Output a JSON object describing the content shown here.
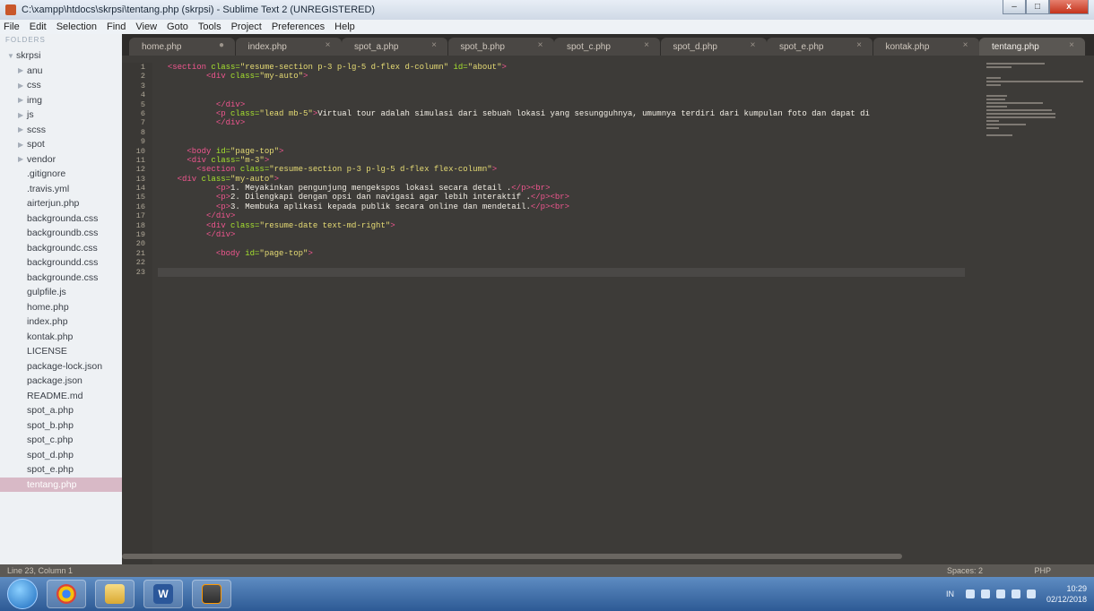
{
  "window": {
    "title": "C:\\xampp\\htdocs\\skrpsi\\tentang.php (skrpsi) - Sublime Text 2 (UNREGISTERED)",
    "controls": [
      "–",
      "□",
      "x"
    ]
  },
  "menu": [
    "File",
    "Edit",
    "Selection",
    "Find",
    "View",
    "Goto",
    "Tools",
    "Project",
    "Preferences",
    "Help"
  ],
  "sidebar": {
    "header": "FOLDERS",
    "items": [
      {
        "label": "skrpsi",
        "kind": "folder-open",
        "depth": 0
      },
      {
        "label": "anu",
        "kind": "folder",
        "depth": 1
      },
      {
        "label": "css",
        "kind": "folder",
        "depth": 1
      },
      {
        "label": "img",
        "kind": "folder",
        "depth": 1
      },
      {
        "label": "js",
        "kind": "folder",
        "depth": 1
      },
      {
        "label": "scss",
        "kind": "folder",
        "depth": 1
      },
      {
        "label": "spot",
        "kind": "folder",
        "depth": 1
      },
      {
        "label": "vendor",
        "kind": "folder",
        "depth": 1
      },
      {
        "label": ".gitignore",
        "kind": "file",
        "depth": 1
      },
      {
        "label": ".travis.yml",
        "kind": "file",
        "depth": 1
      },
      {
        "label": "airterjun.php",
        "kind": "file",
        "depth": 1
      },
      {
        "label": "backgrounda.css",
        "kind": "file",
        "depth": 1
      },
      {
        "label": "backgroundb.css",
        "kind": "file",
        "depth": 1
      },
      {
        "label": "backgroundc.css",
        "kind": "file",
        "depth": 1
      },
      {
        "label": "backgroundd.css",
        "kind": "file",
        "depth": 1
      },
      {
        "label": "backgrounde.css",
        "kind": "file",
        "depth": 1
      },
      {
        "label": "gulpfile.js",
        "kind": "file",
        "depth": 1
      },
      {
        "label": "home.php",
        "kind": "file",
        "depth": 1
      },
      {
        "label": "index.php",
        "kind": "file",
        "depth": 1
      },
      {
        "label": "kontak.php",
        "kind": "file",
        "depth": 1
      },
      {
        "label": "LICENSE",
        "kind": "file",
        "depth": 1
      },
      {
        "label": "package-lock.json",
        "kind": "file",
        "depth": 1
      },
      {
        "label": "package.json",
        "kind": "file",
        "depth": 1
      },
      {
        "label": "README.md",
        "kind": "file",
        "depth": 1
      },
      {
        "label": "spot_a.php",
        "kind": "file",
        "depth": 1
      },
      {
        "label": "spot_b.php",
        "kind": "file",
        "depth": 1
      },
      {
        "label": "spot_c.php",
        "kind": "file",
        "depth": 1
      },
      {
        "label": "spot_d.php",
        "kind": "file",
        "depth": 1
      },
      {
        "label": "spot_e.php",
        "kind": "file",
        "depth": 1
      },
      {
        "label": "tentang.php",
        "kind": "file",
        "depth": 1,
        "selected": true
      }
    ]
  },
  "tabs": [
    {
      "label": "home.php",
      "close": "●"
    },
    {
      "label": "index.php",
      "close": "×"
    },
    {
      "label": "spot_a.php",
      "close": "×"
    },
    {
      "label": "spot_b.php",
      "close": "×"
    },
    {
      "label": "spot_c.php",
      "close": "×"
    },
    {
      "label": "spot_d.php",
      "close": "×"
    },
    {
      "label": "spot_e.php",
      "close": "×"
    },
    {
      "label": "kontak.php",
      "close": "×"
    },
    {
      "label": "tentang.php",
      "close": "×",
      "active": true
    }
  ],
  "code": {
    "line_numbers": [
      "1",
      "2",
      "3",
      "4",
      "5",
      "6",
      "7",
      "8",
      "9",
      "10",
      "11",
      "12",
      "13",
      "14",
      "15",
      "16",
      "17",
      "18",
      "19",
      "20",
      "21",
      "22",
      "23"
    ],
    "current_line": 23,
    "lines": [
      [
        [
          "  ",
          "txt"
        ],
        [
          "<section ",
          "tag"
        ],
        [
          "class=",
          "attr"
        ],
        [
          "\"resume-section p-3 p-lg-5 d-flex d-column\" ",
          "str"
        ],
        [
          "id=",
          "attr"
        ],
        [
          "\"about\"",
          "str"
        ],
        [
          ">",
          "tag"
        ]
      ],
      [
        [
          "          ",
          "txt"
        ],
        [
          "<div ",
          "tag"
        ],
        [
          "class=",
          "attr"
        ],
        [
          "\"my-auto\"",
          "str"
        ],
        [
          ">",
          "tag"
        ]
      ],
      [],
      [],
      [
        [
          "            ",
          "txt"
        ],
        [
          "</div>",
          "tag"
        ]
      ],
      [
        [
          "            ",
          "txt"
        ],
        [
          "<p ",
          "tag"
        ],
        [
          "class=",
          "attr"
        ],
        [
          "\"lead mb-5\"",
          "str"
        ],
        [
          ">",
          "tag"
        ],
        [
          "Virtual tour adalah simulasi dari sebuah lokasi yang sesungguhnya, umumnya terdiri dari kumpulan foto dan dapat di",
          "txt"
        ]
      ],
      [
        [
          "            ",
          "txt"
        ],
        [
          "</div>",
          "tag"
        ]
      ],
      [],
      [],
      [
        [
          "      ",
          "txt"
        ],
        [
          "<body ",
          "tag"
        ],
        [
          "id=",
          "attr"
        ],
        [
          "\"page-top\"",
          "str"
        ],
        [
          ">",
          "tag"
        ]
      ],
      [
        [
          "      ",
          "txt"
        ],
        [
          "<div ",
          "tag"
        ],
        [
          "class=",
          "attr"
        ],
        [
          "\"m-3\"",
          "str"
        ],
        [
          ">",
          "tag"
        ]
      ],
      [
        [
          "        ",
          "txt"
        ],
        [
          "<section ",
          "tag"
        ],
        [
          "class=",
          "attr"
        ],
        [
          "\"resume-section p-3 p-lg-5 d-flex flex-column\"",
          "str"
        ],
        [
          ">",
          "tag"
        ]
      ],
      [
        [
          "    ",
          "txt"
        ],
        [
          "<div ",
          "tag"
        ],
        [
          "class=",
          "attr"
        ],
        [
          "\"my-auto\"",
          "str"
        ],
        [
          ">",
          "tag"
        ]
      ],
      [
        [
          "            ",
          "txt"
        ],
        [
          "<p>",
          "tag"
        ],
        [
          "1. Meyakinkan pengunjung mengekspos lokasi secara detail .",
          "txt"
        ],
        [
          "</p><br>",
          "tag"
        ]
      ],
      [
        [
          "            ",
          "txt"
        ],
        [
          "<p>",
          "tag"
        ],
        [
          "2. Dilengkapi dengan opsi dan navigasi agar lebih interaktif .",
          "txt"
        ],
        [
          "</p><br>",
          "tag"
        ]
      ],
      [
        [
          "            ",
          "txt"
        ],
        [
          "<p>",
          "tag"
        ],
        [
          "3. Membuka aplikasi kepada publik secara online dan mendetail.",
          "txt"
        ],
        [
          "</p><br>",
          "tag"
        ]
      ],
      [
        [
          "          ",
          "txt"
        ],
        [
          "</div>",
          "tag"
        ]
      ],
      [
        [
          "          ",
          "txt"
        ],
        [
          "<div ",
          "tag"
        ],
        [
          "class=",
          "attr"
        ],
        [
          "\"resume-date text-md-right\"",
          "str"
        ],
        [
          ">",
          "tag"
        ]
      ],
      [
        [
          "          ",
          "txt"
        ],
        [
          "</div>",
          "tag"
        ]
      ],
      [],
      [
        [
          "            ",
          "txt"
        ],
        [
          "<body ",
          "tag"
        ],
        [
          "id=",
          "attr"
        ],
        [
          "\"page-top\"",
          "str"
        ],
        [
          ">",
          "tag"
        ]
      ],
      [],
      []
    ]
  },
  "status": {
    "position": "Line 23, Column 1",
    "spaces": "Spaces: 2",
    "syntax": "PHP"
  },
  "taskbar": {
    "apps": [
      "chrome",
      "explorer",
      "word",
      "sublime"
    ],
    "language": "IN",
    "time": "10:29",
    "date": "02/12/2018"
  }
}
